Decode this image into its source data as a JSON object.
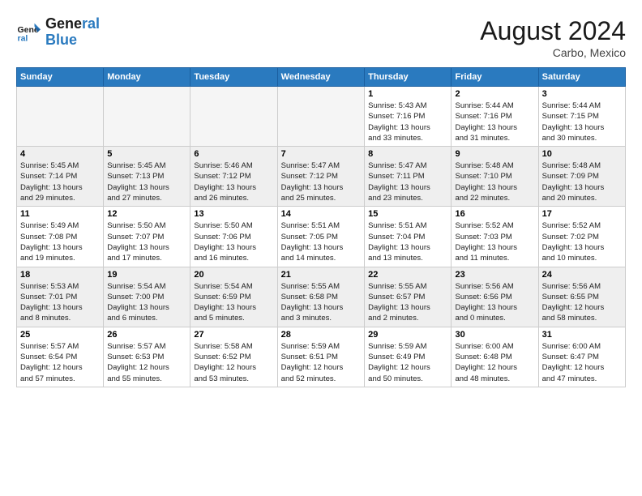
{
  "logo": {
    "text_general": "General",
    "text_blue": "Blue"
  },
  "title": {
    "month_year": "August 2024",
    "location": "Carbo, Mexico"
  },
  "headers": [
    "Sunday",
    "Monday",
    "Tuesday",
    "Wednesday",
    "Thursday",
    "Friday",
    "Saturday"
  ],
  "weeks": [
    {
      "alt": false,
      "days": [
        {
          "num": "",
          "info": ""
        },
        {
          "num": "",
          "info": ""
        },
        {
          "num": "",
          "info": ""
        },
        {
          "num": "",
          "info": ""
        },
        {
          "num": "1",
          "info": "Sunrise: 5:43 AM\nSunset: 7:16 PM\nDaylight: 13 hours\nand 33 minutes."
        },
        {
          "num": "2",
          "info": "Sunrise: 5:44 AM\nSunset: 7:16 PM\nDaylight: 13 hours\nand 31 minutes."
        },
        {
          "num": "3",
          "info": "Sunrise: 5:44 AM\nSunset: 7:15 PM\nDaylight: 13 hours\nand 30 minutes."
        }
      ]
    },
    {
      "alt": true,
      "days": [
        {
          "num": "4",
          "info": "Sunrise: 5:45 AM\nSunset: 7:14 PM\nDaylight: 13 hours\nand 29 minutes."
        },
        {
          "num": "5",
          "info": "Sunrise: 5:45 AM\nSunset: 7:13 PM\nDaylight: 13 hours\nand 27 minutes."
        },
        {
          "num": "6",
          "info": "Sunrise: 5:46 AM\nSunset: 7:12 PM\nDaylight: 13 hours\nand 26 minutes."
        },
        {
          "num": "7",
          "info": "Sunrise: 5:47 AM\nSunset: 7:12 PM\nDaylight: 13 hours\nand 25 minutes."
        },
        {
          "num": "8",
          "info": "Sunrise: 5:47 AM\nSunset: 7:11 PM\nDaylight: 13 hours\nand 23 minutes."
        },
        {
          "num": "9",
          "info": "Sunrise: 5:48 AM\nSunset: 7:10 PM\nDaylight: 13 hours\nand 22 minutes."
        },
        {
          "num": "10",
          "info": "Sunrise: 5:48 AM\nSunset: 7:09 PM\nDaylight: 13 hours\nand 20 minutes."
        }
      ]
    },
    {
      "alt": false,
      "days": [
        {
          "num": "11",
          "info": "Sunrise: 5:49 AM\nSunset: 7:08 PM\nDaylight: 13 hours\nand 19 minutes."
        },
        {
          "num": "12",
          "info": "Sunrise: 5:50 AM\nSunset: 7:07 PM\nDaylight: 13 hours\nand 17 minutes."
        },
        {
          "num": "13",
          "info": "Sunrise: 5:50 AM\nSunset: 7:06 PM\nDaylight: 13 hours\nand 16 minutes."
        },
        {
          "num": "14",
          "info": "Sunrise: 5:51 AM\nSunset: 7:05 PM\nDaylight: 13 hours\nand 14 minutes."
        },
        {
          "num": "15",
          "info": "Sunrise: 5:51 AM\nSunset: 7:04 PM\nDaylight: 13 hours\nand 13 minutes."
        },
        {
          "num": "16",
          "info": "Sunrise: 5:52 AM\nSunset: 7:03 PM\nDaylight: 13 hours\nand 11 minutes."
        },
        {
          "num": "17",
          "info": "Sunrise: 5:52 AM\nSunset: 7:02 PM\nDaylight: 13 hours\nand 10 minutes."
        }
      ]
    },
    {
      "alt": true,
      "days": [
        {
          "num": "18",
          "info": "Sunrise: 5:53 AM\nSunset: 7:01 PM\nDaylight: 13 hours\nand 8 minutes."
        },
        {
          "num": "19",
          "info": "Sunrise: 5:54 AM\nSunset: 7:00 PM\nDaylight: 13 hours\nand 6 minutes."
        },
        {
          "num": "20",
          "info": "Sunrise: 5:54 AM\nSunset: 6:59 PM\nDaylight: 13 hours\nand 5 minutes."
        },
        {
          "num": "21",
          "info": "Sunrise: 5:55 AM\nSunset: 6:58 PM\nDaylight: 13 hours\nand 3 minutes."
        },
        {
          "num": "22",
          "info": "Sunrise: 5:55 AM\nSunset: 6:57 PM\nDaylight: 13 hours\nand 2 minutes."
        },
        {
          "num": "23",
          "info": "Sunrise: 5:56 AM\nSunset: 6:56 PM\nDaylight: 13 hours\nand 0 minutes."
        },
        {
          "num": "24",
          "info": "Sunrise: 5:56 AM\nSunset: 6:55 PM\nDaylight: 12 hours\nand 58 minutes."
        }
      ]
    },
    {
      "alt": false,
      "days": [
        {
          "num": "25",
          "info": "Sunrise: 5:57 AM\nSunset: 6:54 PM\nDaylight: 12 hours\nand 57 minutes."
        },
        {
          "num": "26",
          "info": "Sunrise: 5:57 AM\nSunset: 6:53 PM\nDaylight: 12 hours\nand 55 minutes."
        },
        {
          "num": "27",
          "info": "Sunrise: 5:58 AM\nSunset: 6:52 PM\nDaylight: 12 hours\nand 53 minutes."
        },
        {
          "num": "28",
          "info": "Sunrise: 5:59 AM\nSunset: 6:51 PM\nDaylight: 12 hours\nand 52 minutes."
        },
        {
          "num": "29",
          "info": "Sunrise: 5:59 AM\nSunset: 6:49 PM\nDaylight: 12 hours\nand 50 minutes."
        },
        {
          "num": "30",
          "info": "Sunrise: 6:00 AM\nSunset: 6:48 PM\nDaylight: 12 hours\nand 48 minutes."
        },
        {
          "num": "31",
          "info": "Sunrise: 6:00 AM\nSunset: 6:47 PM\nDaylight: 12 hours\nand 47 minutes."
        }
      ]
    }
  ]
}
